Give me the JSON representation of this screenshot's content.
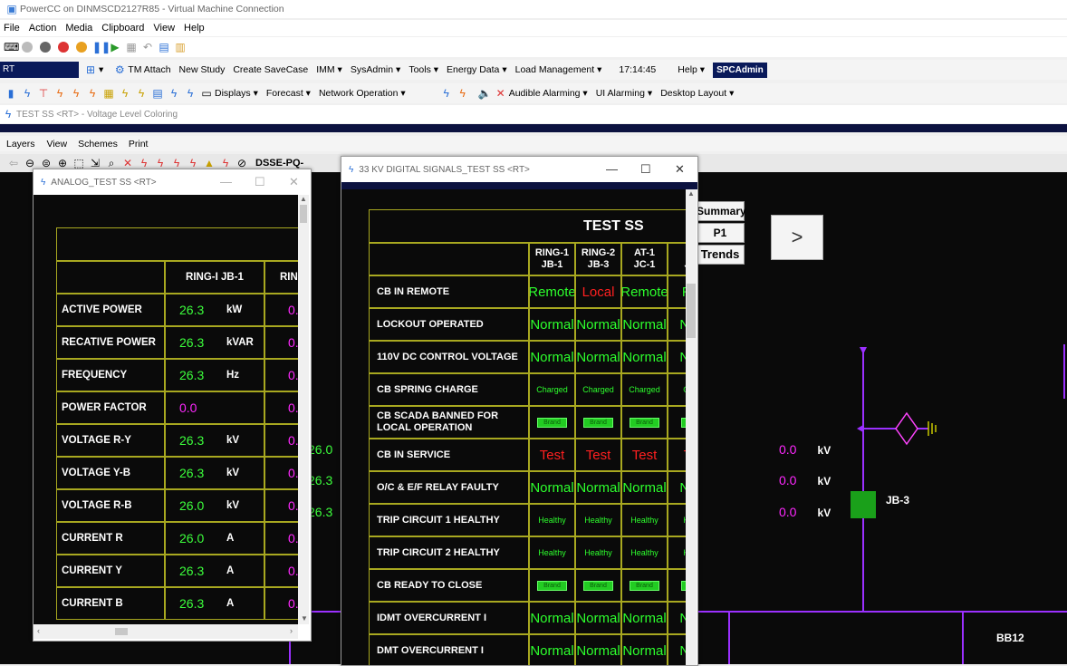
{
  "vm": {
    "title": "PowerCC on DINMSCD2127R85 - Virtual Machine Connection",
    "menu": [
      "File",
      "Action",
      "Media",
      "Clipboard",
      "View",
      "Help"
    ]
  },
  "appbar1": {
    "mode": "RT",
    "items": [
      "TM Attach",
      "New Study",
      "Create SaveCase",
      "IMM",
      "SysAdmin",
      "Tools",
      "Energy Data",
      "Load Management"
    ],
    "time": "17:14:45",
    "help": "Help",
    "user": "SPCAdmin"
  },
  "appbar2": {
    "items": [
      "Displays",
      "Forecast",
      "Network Operation",
      "Audible Alarming",
      "UI Alarming",
      "Desktop Layout"
    ]
  },
  "display": {
    "title": "TEST SS <RT> - Voltage Level Coloring",
    "menu": [
      "Layers",
      "View",
      "Schemes",
      "Print"
    ],
    "toolbar_label": "DSSE-PQ-"
  },
  "analog": {
    "title": "ANALOG_TEST SS <RT>",
    "col1": "RING-I JB-1",
    "col2": "RIN",
    "rows": [
      {
        "label": "ACTIVE POWER",
        "value": "26.3",
        "unit": "kW",
        "v2": "0."
      },
      {
        "label": "RECATIVE POWER",
        "value": "26.3",
        "unit": "kVAR",
        "v2": "0."
      },
      {
        "label": "FREQUENCY",
        "value": "26.3",
        "unit": "Hz",
        "v2": "0."
      },
      {
        "label": "POWER FACTOR",
        "value": "0.0",
        "unit": "",
        "v2": "0."
      },
      {
        "label": "VOLTAGE R-Y",
        "value": "26.3",
        "unit": "kV",
        "v2": "0."
      },
      {
        "label": "VOLTAGE Y-B",
        "value": "26.3",
        "unit": "kV",
        "v2": "0."
      },
      {
        "label": "VOLTAGE R-B",
        "value": "26.0",
        "unit": "kV",
        "v2": "0."
      },
      {
        "label": "CURRENT R",
        "value": "26.0",
        "unit": "A",
        "v2": "0."
      },
      {
        "label": "CURRENT Y",
        "value": "26.3",
        "unit": "A",
        "v2": "0."
      },
      {
        "label": "CURRENT B",
        "value": "26.3",
        "unit": "A",
        "v2": "0."
      }
    ]
  },
  "behind_values": [
    "26.0",
    "26.3",
    "26.3"
  ],
  "digital": {
    "title": "33 KV DIGITAL SIGNALS_TEST SS <RT>",
    "heading": "TEST SS",
    "cols": [
      [
        "RING-1",
        "JB-1"
      ],
      [
        "RING-2",
        "JB-3"
      ],
      [
        "AT-1",
        "JC-1"
      ],
      [
        "A",
        "JC"
      ]
    ],
    "rows": [
      {
        "label": "CB IN REMOTE",
        "vals": [
          "Remote",
          "Local",
          "Remote",
          "Re"
        ],
        "colors": [
          "#2dff2d",
          "#ff2020",
          "#2dff2d",
          "#2dff2d"
        ],
        "kind": "text"
      },
      {
        "label": "LOCKOUT OPERATED",
        "vals": [
          "Normal",
          "Normal",
          "Normal",
          "Nor"
        ],
        "colors": [
          "#2dff2d",
          "#2dff2d",
          "#2dff2d",
          "#2dff2d"
        ],
        "kind": "text"
      },
      {
        "label": "110V DC CONTROL VOLTAGE",
        "vals": [
          "Normal",
          "Normal",
          "Normal",
          "Nor"
        ],
        "colors": [
          "#2dff2d",
          "#2dff2d",
          "#2dff2d",
          "#2dff2d"
        ],
        "kind": "text"
      },
      {
        "label": "CB SPRING CHARGE",
        "vals": [
          "Charged",
          "Charged",
          "Charged",
          "Cha"
        ],
        "colors": [
          "#2dff2d",
          "#2dff2d",
          "#2dff2d",
          "#2dff2d"
        ],
        "kind": "small"
      },
      {
        "label": "CB SCADA BANNED FOR LOCAL OPERATION",
        "vals": [
          "Brand",
          "Brand",
          "Brand",
          "Br"
        ],
        "colors": [
          "#2dff2d",
          "#2dff2d",
          "#2dff2d",
          "#2dff2d"
        ],
        "kind": "badge"
      },
      {
        "label": "CB IN SERVICE",
        "vals": [
          "Test",
          "Test",
          "Test",
          "Te"
        ],
        "colors": [
          "#ff2020",
          "#ff2020",
          "#ff2020",
          "#ff2020"
        ],
        "kind": "text"
      },
      {
        "label": "O/C & E/F RELAY FAULTY",
        "vals": [
          "Normal",
          "Normal",
          "Normal",
          "Nor"
        ],
        "colors": [
          "#2dff2d",
          "#2dff2d",
          "#2dff2d",
          "#2dff2d"
        ],
        "kind": "text"
      },
      {
        "label": "TRIP CIRCUIT 1 HEALTHY",
        "vals": [
          "Healthy",
          "Healthy",
          "Healthy",
          "Hea"
        ],
        "colors": [
          "#2dff2d",
          "#2dff2d",
          "#2dff2d",
          "#2dff2d"
        ],
        "kind": "small"
      },
      {
        "label": "TRIP CIRCUIT 2 HEALTHY",
        "vals": [
          "Healthy",
          "Healthy",
          "Healthy",
          "Hea"
        ],
        "colors": [
          "#2dff2d",
          "#2dff2d",
          "#2dff2d",
          "#2dff2d"
        ],
        "kind": "small"
      },
      {
        "label": "CB READY TO CLOSE",
        "vals": [
          "Brand",
          "Brand",
          "Brand",
          "Br"
        ],
        "colors": [
          "#2dff2d",
          "#2dff2d",
          "#2dff2d",
          "#2dff2d"
        ],
        "kind": "badge"
      },
      {
        "label": "IDMT OVERCURRENT I",
        "vals": [
          "Normal",
          "Normal",
          "Normal",
          "Nor"
        ],
        "colors": [
          "#2dff2d",
          "#2dff2d",
          "#2dff2d",
          "#2dff2d"
        ],
        "kind": "text"
      },
      {
        "label": "DMT OVERCURRENT I",
        "vals": [
          "Normal",
          "Normal",
          "Normal",
          "Nor"
        ],
        "colors": [
          "#2dff2d",
          "#2dff2d",
          "#2dff2d",
          "#2dff2d"
        ],
        "kind": "text"
      }
    ]
  },
  "side_buttons": [
    "Summary",
    "P1",
    "Trends"
  ],
  "next_button": ">",
  "schematic": {
    "readings": [
      {
        "value": "0.0",
        "unit": "kV"
      },
      {
        "value": "0.0",
        "unit": "kV"
      },
      {
        "value": "0.0",
        "unit": "kV"
      }
    ],
    "breaker_label": "JB-3",
    "bus_label": "BB12"
  }
}
